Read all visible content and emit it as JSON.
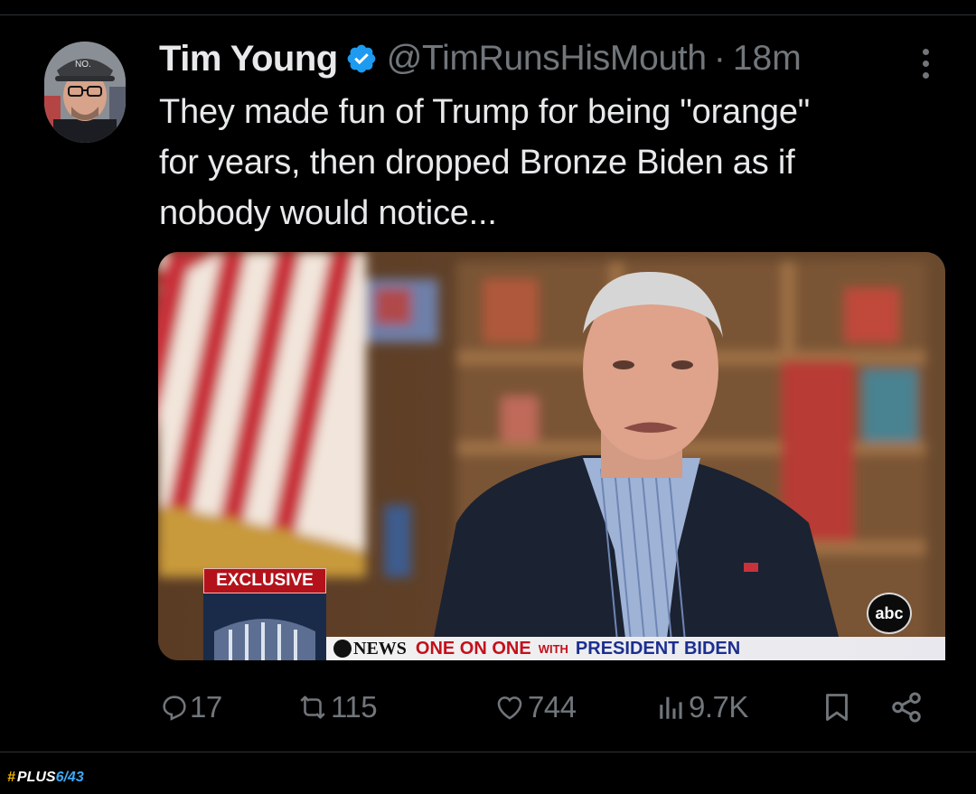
{
  "tweet": {
    "author": {
      "display_name": "Tim Young",
      "verified": true,
      "handle": "@TimRunsHisMouth",
      "separator": "·",
      "timestamp": "18m",
      "avatar_cap_text": "NO."
    },
    "text_lines": [
      "They made fun of Trump for being \"orange\"",
      "for years, then dropped Bronze Biden as if",
      "nobody would notice..."
    ],
    "media": {
      "exclusive_tag": "EXCLUSIVE",
      "network_logo": "abc",
      "lower_third": {
        "news_label": "NEWS",
        "part1": "ONE ON ONE",
        "part2": "WITH",
        "part3": "PRESIDENT BIDEN"
      }
    },
    "actions": {
      "replies": "17",
      "reposts": "115",
      "likes": "744",
      "views": "9.7K"
    }
  },
  "icons": {
    "more": "more-vertical-icon",
    "reply": "reply-icon",
    "repost": "repost-icon",
    "like": "heart-icon",
    "views": "views-chart-icon",
    "bookmark": "bookmark-icon",
    "share": "share-icon"
  },
  "colors": {
    "background": "#000000",
    "text_primary": "#e7e9ea",
    "text_secondary": "#71767b",
    "verified": "#1d9bf0",
    "divider": "#2f3336"
  },
  "watermark": {
    "hash": "#",
    "text": "PLUS",
    "num": "6/43"
  }
}
